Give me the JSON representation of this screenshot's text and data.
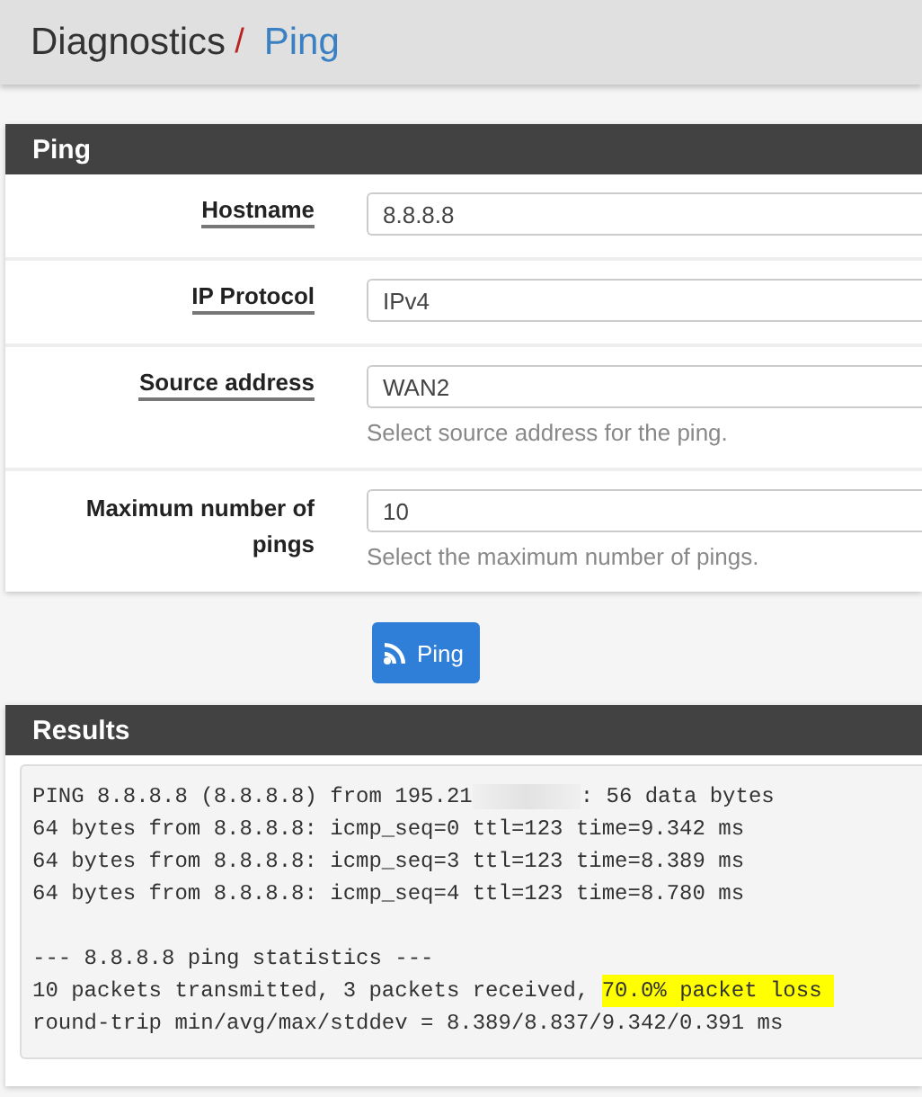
{
  "breadcrumb": {
    "section": "Diagnostics",
    "separator": "/",
    "page": "Ping"
  },
  "form_panel": {
    "title": "Ping",
    "fields": [
      {
        "label": "Hostname",
        "underlined": true,
        "value": "8.8.8.8"
      },
      {
        "label": "IP Protocol",
        "underlined": true,
        "value": "IPv4"
      },
      {
        "label": "Source address",
        "underlined": true,
        "value": "WAN2",
        "help": "Select source address for the ping."
      },
      {
        "label": "Maximum number of pings",
        "underlined": false,
        "value": "10",
        "help": "Select the maximum number of pings."
      }
    ]
  },
  "ping_button": {
    "label": "Ping"
  },
  "results_panel": {
    "title": "Results",
    "output_blocks": [
      [
        [
          {
            "kind": "text",
            "text": "PING 8.8.8.8 (8.8.8.8) from 195.21",
            "highlighted": false
          },
          {
            "kind": "redacted"
          },
          {
            "kind": "text",
            "text": ": 56 data bytes",
            "highlighted": false
          }
        ],
        [
          {
            "kind": "text",
            "text": "64 bytes from 8.8.8.8: icmp_seq=0 ttl=123 time=9.342 ms",
            "highlighted": false
          }
        ],
        [
          {
            "kind": "text",
            "text": "64 bytes from 8.8.8.8: icmp_seq=3 ttl=123 time=8.389 ms",
            "highlighted": false
          }
        ],
        [
          {
            "kind": "text",
            "text": "64 bytes from 8.8.8.8: icmp_seq=4 ttl=123 time=8.780 ms",
            "highlighted": false
          }
        ]
      ],
      [
        [
          {
            "kind": "text",
            "text": "--- 8.8.8.8 ping statistics ---",
            "highlighted": false
          }
        ],
        [
          {
            "kind": "text",
            "text": "10 packets transmitted, 3 packets received, ",
            "highlighted": false
          },
          {
            "kind": "text",
            "text": "70.0% packet loss ",
            "highlighted": true
          }
        ],
        [
          {
            "kind": "text",
            "text": "round-trip min/avg/max/stddev = 8.389/8.837/9.342/0.391 ms",
            "highlighted": false
          }
        ]
      ]
    ]
  }
}
